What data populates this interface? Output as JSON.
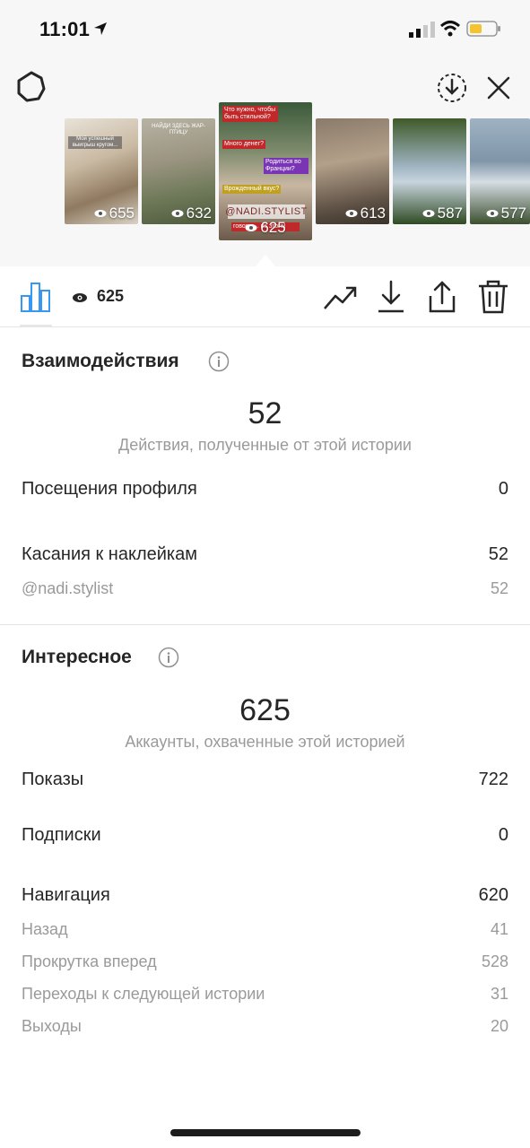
{
  "status_bar": {
    "time": "11:01"
  },
  "stories": [
    {
      "views": "655",
      "text": "Мой успешный выигрыш кругом..."
    },
    {
      "views": "632",
      "text": "НАЙДИ ЗДЕСЬ ЖАР-ПТИЦУ"
    },
    {
      "views": "625",
      "tags": [
        "Что нужно, чтобы быть стильной?",
        "Много денег?",
        "Родиться во Франции?",
        "Врожденный вкус?"
      ],
      "handle": "@NADI.STYLIST",
      "footer": "говорю... из этого!"
    },
    {
      "views": "613"
    },
    {
      "views": "587"
    },
    {
      "views": "577"
    }
  ],
  "toolbar": {
    "reach_count": "625"
  },
  "interactions": {
    "title": "Взаимодействия",
    "total": "52",
    "total_caption": "Действия, полученные от этой истории",
    "rows": [
      {
        "label": "Посещения профиля",
        "value": "0"
      },
      {
        "label": "Касания к наклейкам",
        "value": "52"
      }
    ],
    "sub_rows": [
      {
        "label": "@nadi.stylist",
        "value": "52"
      }
    ]
  },
  "discovery": {
    "title": "Интересное",
    "total": "625",
    "total_caption": "Аккаунты, охваченные этой историей",
    "rows": [
      {
        "label": "Показы",
        "value": "722"
      },
      {
        "label": "Подписки",
        "value": "0"
      },
      {
        "label": "Навигация",
        "value": "620"
      }
    ],
    "sub_rows": [
      {
        "label": "Назад",
        "value": "41"
      },
      {
        "label": "Прокрутка вперед",
        "value": "528"
      },
      {
        "label": "Переходы к следующей истории",
        "value": "31"
      },
      {
        "label": "Выходы",
        "value": "20"
      }
    ]
  },
  "colors": {
    "accent": "#3897f0",
    "text": "#262626",
    "muted": "#9a9a9a"
  }
}
